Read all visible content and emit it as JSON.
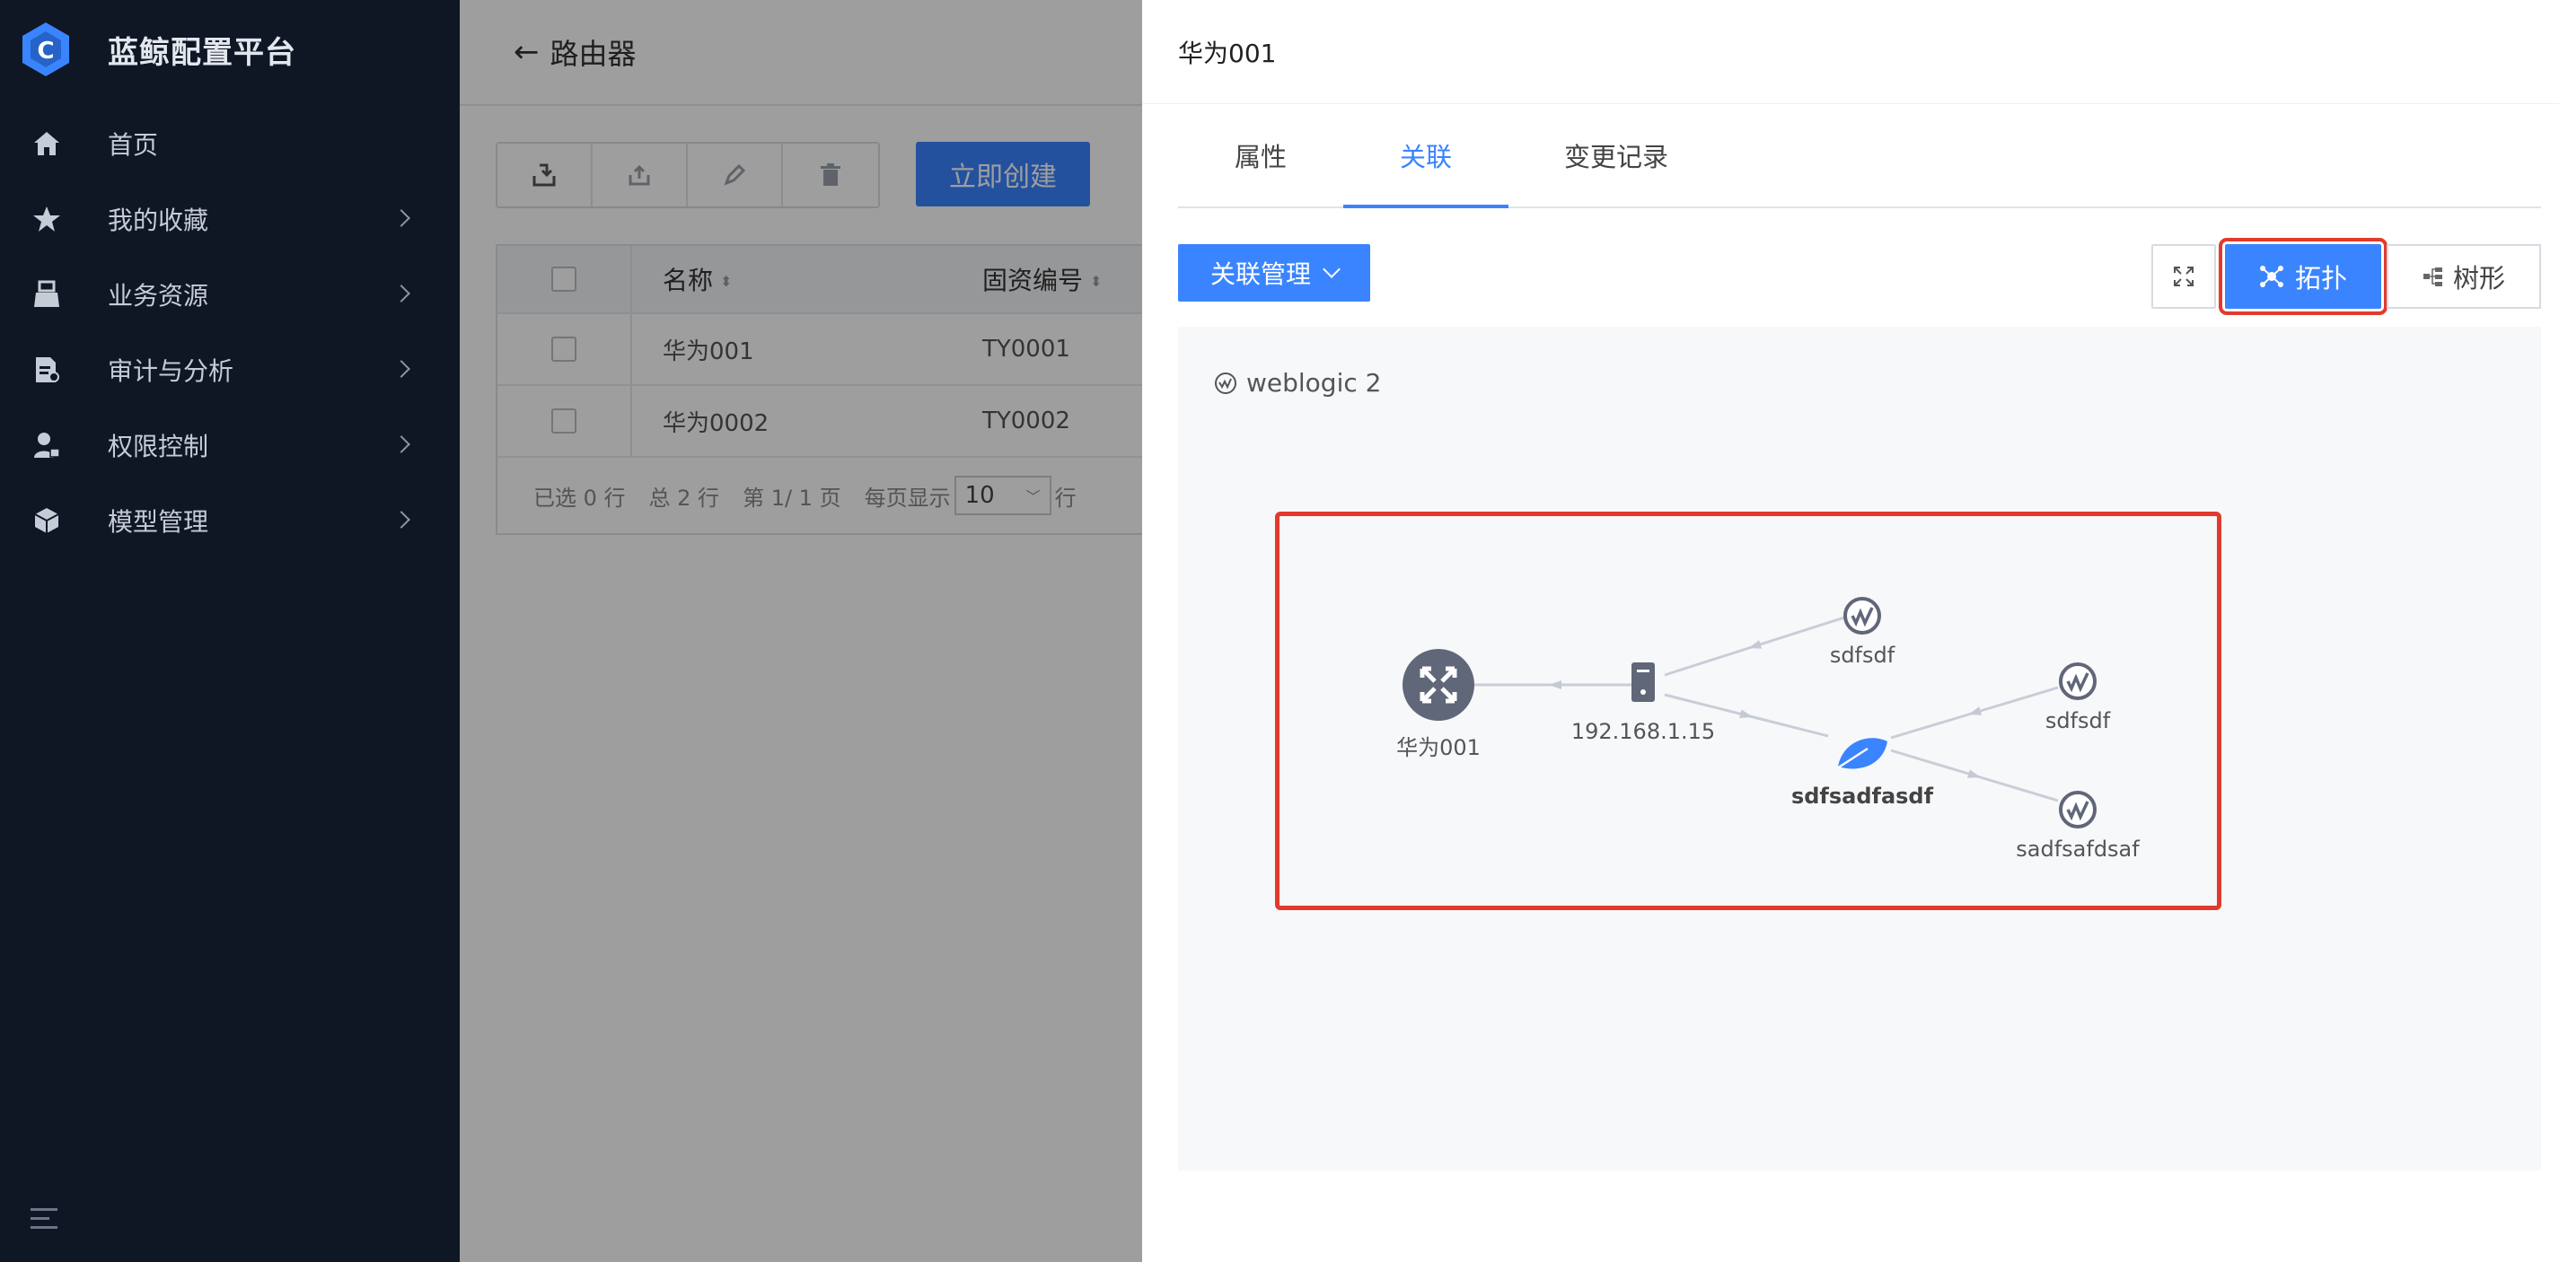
{
  "app": {
    "title": "蓝鲸配置平台"
  },
  "sidebar": {
    "items": [
      {
        "label": "首页",
        "icon": "home-icon"
      },
      {
        "label": "我的收藏",
        "icon": "star-icon"
      },
      {
        "label": "业务资源",
        "icon": "business-icon"
      },
      {
        "label": "审计与分析",
        "icon": "audit-icon"
      },
      {
        "label": "权限控制",
        "icon": "permission-icon"
      },
      {
        "label": "模型管理",
        "icon": "model-icon"
      }
    ]
  },
  "main": {
    "back_label": "路由器",
    "create_label": "立即创建",
    "table": {
      "columns": [
        "名称",
        "固资编号"
      ],
      "rows": [
        {
          "name": "华为001",
          "code": "TY0001"
        },
        {
          "name": "华为0002",
          "code": "TY0002"
        }
      ]
    },
    "footer": {
      "selected": "已选 0 行",
      "total": "总 2 行",
      "page": "第 1/ 1 页",
      "per_page_label": "每页显示",
      "per_page": "10",
      "unit": "行"
    }
  },
  "panel": {
    "title": "华为001",
    "tabs": [
      "属性",
      "关联",
      "变更记录"
    ],
    "active_tab": "关联",
    "relation_button": "关联管理",
    "view_buttons": {
      "topo": "拓扑",
      "tree": "树形"
    },
    "canvas_title": "weblogic 2",
    "topology": {
      "nodes": [
        {
          "id": "n1",
          "label": "华为001",
          "type": "router"
        },
        {
          "id": "n2",
          "label": "192.168.1.15",
          "type": "server"
        },
        {
          "id": "n3",
          "label": "sdfsdf",
          "type": "weblogic"
        },
        {
          "id": "n4",
          "label": "sdfsadfasdf",
          "type": "leaf",
          "highlight": true
        },
        {
          "id": "n5",
          "label": "sdfsdf",
          "type": "weblogic"
        },
        {
          "id": "n6",
          "label": "sadfsafdsaf",
          "type": "weblogic"
        }
      ],
      "edges": [
        {
          "from": "n2",
          "to": "n1"
        },
        {
          "from": "n3",
          "to": "n2"
        },
        {
          "from": "n2",
          "to": "n4"
        },
        {
          "from": "n5",
          "to": "n4"
        },
        {
          "from": "n4",
          "to": "n6"
        }
      ]
    },
    "colors": {
      "accent": "#3a84ff",
      "highlight": "#e23a2d"
    }
  }
}
